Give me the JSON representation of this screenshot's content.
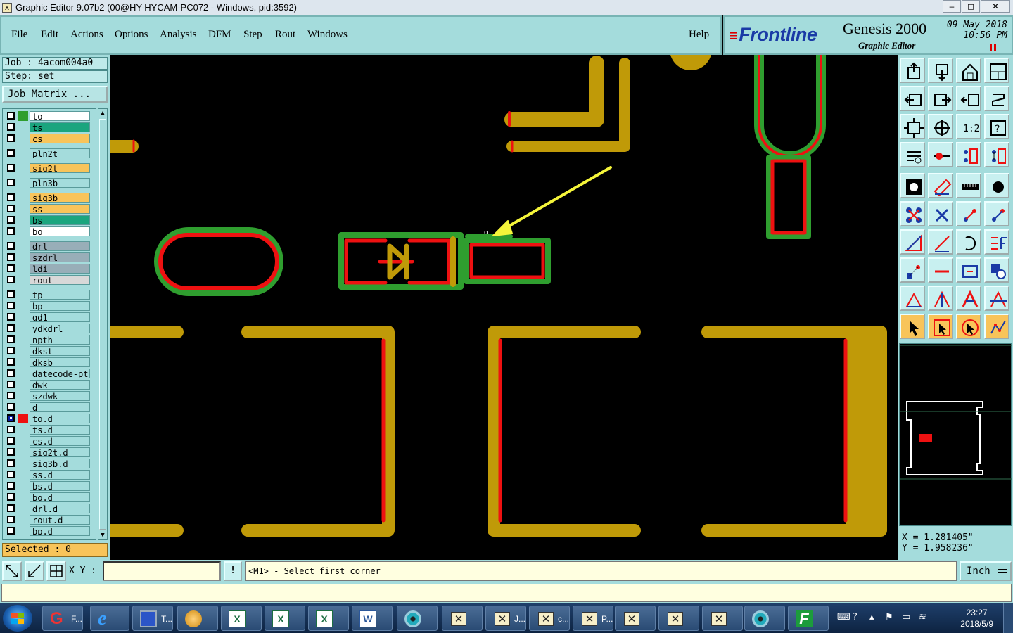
{
  "window": {
    "title": "Graphic Editor 9.07b2 (00@HY-HYCAM-PC072 - Windows, pid:3592)",
    "controls": [
      "–",
      "◻",
      "✕"
    ]
  },
  "menu": [
    {
      "label": "File"
    },
    {
      "label": "Edit"
    },
    {
      "label": "Actions"
    },
    {
      "label": "Options"
    },
    {
      "label": "Analysis"
    },
    {
      "label": "DFM"
    },
    {
      "label": "Step"
    },
    {
      "label": "Rout"
    },
    {
      "label": "Windows"
    }
  ],
  "help_label": "Help",
  "brand": {
    "logo": "Frontline",
    "product": "Genesis 2000",
    "subtitle": "Graphic Editor",
    "date_line1": "09 May 2018",
    "date_line2": "10:56 PM"
  },
  "job": {
    "job_line": "Job : 4acom004a0",
    "step_line": "Step: set",
    "matrix_button": "Job Matrix ...",
    "selected": "Selected : 0"
  },
  "layers": [
    {
      "name": "to",
      "bg": "#ffffff",
      "swatch": "#2f9e2f",
      "checked": false
    },
    {
      "name": "ts",
      "bg": "#1aa57e",
      "swatch": "",
      "checked": false
    },
    {
      "name": "cs",
      "bg": "#f8c45a",
      "swatch": "",
      "checked": false
    },
    {
      "name": "pln2t",
      "bg": "#a4dcdc",
      "swatch": "",
      "checked": false
    },
    {
      "name": "sig2t",
      "bg": "#f8c45a",
      "swatch": "",
      "checked": false
    },
    {
      "name": "pln3b",
      "bg": "#a4dcdc",
      "swatch": "",
      "checked": false
    },
    {
      "name": "sig3b",
      "bg": "#f8c45a",
      "swatch": "",
      "checked": false
    },
    {
      "name": "ss",
      "bg": "#f8c45a",
      "swatch": "",
      "checked": false
    },
    {
      "name": "bs",
      "bg": "#1aa57e",
      "swatch": "",
      "checked": false
    },
    {
      "name": "bo",
      "bg": "#ffffff",
      "swatch": "",
      "checked": false
    },
    {
      "name": "drl",
      "bg": "#98aeb8",
      "swatch": "",
      "checked": false
    },
    {
      "name": "szdrl",
      "bg": "#98aeb8",
      "swatch": "",
      "checked": false
    },
    {
      "name": "ldi",
      "bg": "#98aeb8",
      "swatch": "",
      "checked": false
    },
    {
      "name": "rout",
      "bg": "#d8d8d8",
      "swatch": "",
      "checked": false
    },
    {
      "name": "tp",
      "bg": "#a4dcdc",
      "swatch": "",
      "checked": false
    },
    {
      "name": "bp",
      "bg": "#a4dcdc",
      "swatch": "",
      "checked": false
    },
    {
      "name": "gd1",
      "bg": "#a4dcdc",
      "swatch": "",
      "checked": false
    },
    {
      "name": "ydkdrl",
      "bg": "#a4dcdc",
      "swatch": "",
      "checked": false
    },
    {
      "name": "npth",
      "bg": "#a4dcdc",
      "swatch": "",
      "checked": false
    },
    {
      "name": "dkst",
      "bg": "#a4dcdc",
      "swatch": "",
      "checked": false
    },
    {
      "name": "dksb",
      "bg": "#a4dcdc",
      "swatch": "",
      "checked": false
    },
    {
      "name": "datecode-ptc",
      "bg": "#a4dcdc",
      "swatch": "",
      "checked": false
    },
    {
      "name": "dwk",
      "bg": "#a4dcdc",
      "swatch": "",
      "checked": false
    },
    {
      "name": "szdwk",
      "bg": "#a4dcdc",
      "swatch": "",
      "checked": false
    },
    {
      "name": "d",
      "bg": "#a4dcdc",
      "swatch": "",
      "checked": false
    },
    {
      "name": "to.d",
      "bg": "#a4dcdc",
      "swatch": "#ee1111",
      "checked": true
    },
    {
      "name": "ts.d",
      "bg": "#a4dcdc",
      "swatch": "",
      "checked": false
    },
    {
      "name": "cs.d",
      "bg": "#a4dcdc",
      "swatch": "",
      "checked": false
    },
    {
      "name": "sig2t.d",
      "bg": "#a4dcdc",
      "swatch": "",
      "checked": false
    },
    {
      "name": "sig3b.d",
      "bg": "#a4dcdc",
      "swatch": "",
      "checked": false
    },
    {
      "name": "ss.d",
      "bg": "#a4dcdc",
      "swatch": "",
      "checked": false
    },
    {
      "name": "bs.d",
      "bg": "#a4dcdc",
      "swatch": "",
      "checked": false
    },
    {
      "name": "bo.d",
      "bg": "#a4dcdc",
      "swatch": "",
      "checked": false
    },
    {
      "name": "drl.d",
      "bg": "#a4dcdc",
      "swatch": "",
      "checked": false
    },
    {
      "name": "rout.d",
      "bg": "#a4dcdc",
      "swatch": "",
      "checked": false
    },
    {
      "name": "bp.d",
      "bg": "#a4dcdc",
      "swatch": "",
      "checked": false
    }
  ],
  "toolbar_icons": [
    "zoom-home-icon",
    "zoom-down-icon",
    "home-view-icon",
    "window-pan-icon",
    "pan-left-icon",
    "pan-right-icon",
    "pan-split-icon",
    "redraw-icon",
    "fit-screen-icon",
    "zoom-in-icon",
    "one-to-one-icon",
    "help-query-icon",
    "layer-settings-icon",
    "measure-line-icon",
    "net-highlight-icon",
    "net-clear-icon",
    "snapshot-icon",
    "edit-shape-icon",
    "ruler-icon",
    "pad-icon",
    "nodes-icon",
    "cross-icon",
    "connect-icon",
    "connect-red-icon",
    "angle-icon",
    "line-icon",
    "arc-icon",
    "features-icon",
    "move-icon",
    "minus-icon",
    "frame-icon",
    "shapes-icon",
    "triangle-a-icon",
    "triangle-b-icon",
    "triangle-c-icon",
    "triangle-d-icon",
    "select-arrow-icon",
    "select-box-icon",
    "select-circle-icon",
    "select-route-icon"
  ],
  "coords": {
    "x": "X = 1.281405\"",
    "y": "Y = 1.958236\""
  },
  "command": {
    "xy_label": "X Y :",
    "xy_value": "",
    "excl": "!",
    "prompt": "<M1> - Select first corner",
    "unit": "Inch"
  },
  "taskbar": {
    "items": [
      {
        "label": "F...",
        "icon": "genesis-icon"
      },
      {
        "label": "",
        "icon": "internet-explorer-icon"
      },
      {
        "label": "T...",
        "icon": "floppy-save-icon"
      },
      {
        "label": "",
        "icon": "shell-icon"
      },
      {
        "label": "",
        "icon": "excel-icon"
      },
      {
        "label": "",
        "icon": "excel-icon"
      },
      {
        "label": "",
        "icon": "excel-icon"
      },
      {
        "label": "",
        "icon": "word-icon"
      },
      {
        "label": "",
        "icon": "eye-app-icon"
      },
      {
        "label": "",
        "icon": "x-window-icon"
      },
      {
        "label": "J...",
        "icon": "x-window-icon"
      },
      {
        "label": "c...",
        "icon": "x-window-icon"
      },
      {
        "label": "P...",
        "icon": "x-window-icon"
      },
      {
        "label": "",
        "icon": "x-window-icon"
      },
      {
        "label": "",
        "icon": "x-window-icon"
      },
      {
        "label": "",
        "icon": "x-window-icon"
      },
      {
        "label": "",
        "icon": "eye-app-icon"
      },
      {
        "label": "",
        "icon": "frontline-f-icon"
      }
    ],
    "time": "23:27",
    "date": "2018/5/9"
  },
  "colors": {
    "panel": "#a4dcdc",
    "copper": "#c09a08",
    "solder_mask": "#2f9e2f",
    "selected_outline": "#ee1111",
    "arrow": "#f5f53a"
  }
}
